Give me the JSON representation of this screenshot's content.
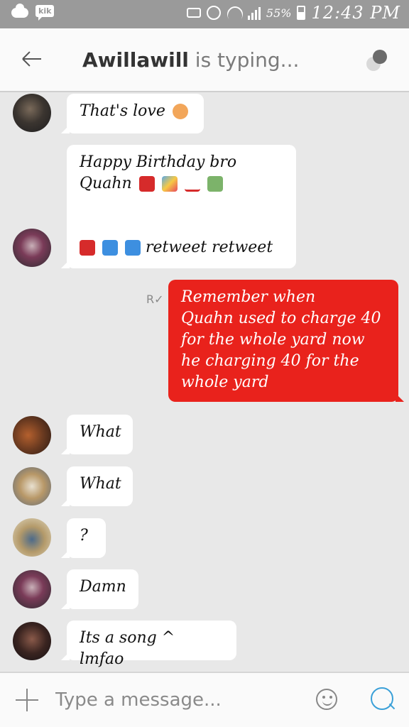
{
  "status_bar": {
    "kik_badge": "kik",
    "battery_percent": "55%",
    "time": "12:43 PM",
    "icons": [
      "cloud-icon",
      "kik-icon",
      "mute-icon",
      "alarm-icon",
      "wifi-icon",
      "signal-icon",
      "battery-icon"
    ]
  },
  "header": {
    "contact_name": "Awillawill",
    "status": " is typing...",
    "back_icon": "arrow-left-icon",
    "options_icon": "options-dots-icon"
  },
  "messages": [
    {
      "direction": "in",
      "text": "That's love",
      "emoji": [
        "#f2a65a"
      ]
    },
    {
      "direction": "in",
      "text_line1": "Happy Birthday bro",
      "text_line2": "Quahn",
      "text_line3": "retweet retweet"
    },
    {
      "direction": "out",
      "read_receipt": "R✓",
      "text_line1": "Remember when",
      "text_line2": "Quahn used to charge 40",
      "text_line3": "for the whole yard now",
      "text_line4": "he charging 40 for the",
      "text_line5": "whole yard"
    },
    {
      "direction": "in",
      "text": "What"
    },
    {
      "direction": "in",
      "text": "What"
    },
    {
      "direction": "in",
      "text": "?"
    },
    {
      "direction": "in",
      "text": "Damn"
    },
    {
      "direction": "in",
      "text": "Its a song ^ lmfao"
    }
  ],
  "composer": {
    "placeholder": "Type a message...",
    "add_icon": "plus-icon",
    "emoji_icon": "smiley-icon",
    "search_icon": "search-icon"
  },
  "colors": {
    "outgoing_bubble": "#e9221c",
    "status_bar": "#9a9a9a",
    "accent": "#3aa0d8"
  }
}
